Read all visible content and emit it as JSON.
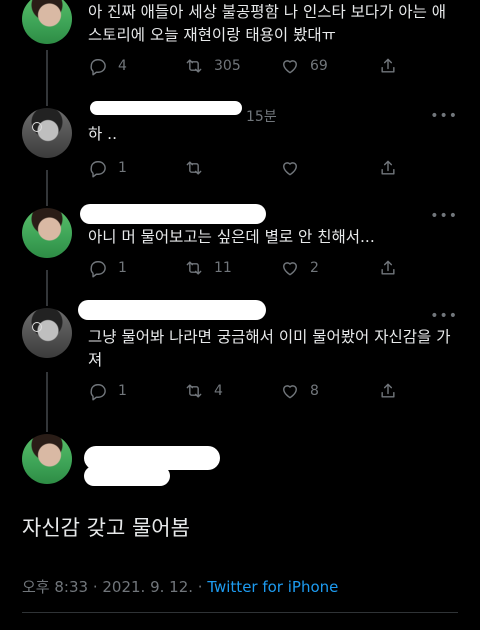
{
  "tweets": [
    {
      "text": "아 진짜 애들아 세상 불공평함 나 인스타 보다가 아는 애 스토리에 오늘 재현이랑 태용이 봤대ㅠ",
      "replies": "4",
      "retweets": "305",
      "likes": "69"
    },
    {
      "time": "15분",
      "text": "하 ..",
      "replies": "1",
      "retweets": "",
      "likes": ""
    },
    {
      "text": "아니 머 물어보고는 싶은데 별로 안 친해서...",
      "replies": "1",
      "retweets": "11",
      "likes": "2"
    },
    {
      "text": "그냥 물어봐 나라면 궁금해서 이미 물어봤어 자신감을 가져",
      "replies": "1",
      "retweets": "4",
      "likes": "8"
    }
  ],
  "main_tweet": {
    "text": "자신감 갖고 물어봄",
    "time": "오후 8:33 · 2021. 9. 12. · ",
    "source": "Twitter for iPhone"
  },
  "more_glyph": "•••"
}
